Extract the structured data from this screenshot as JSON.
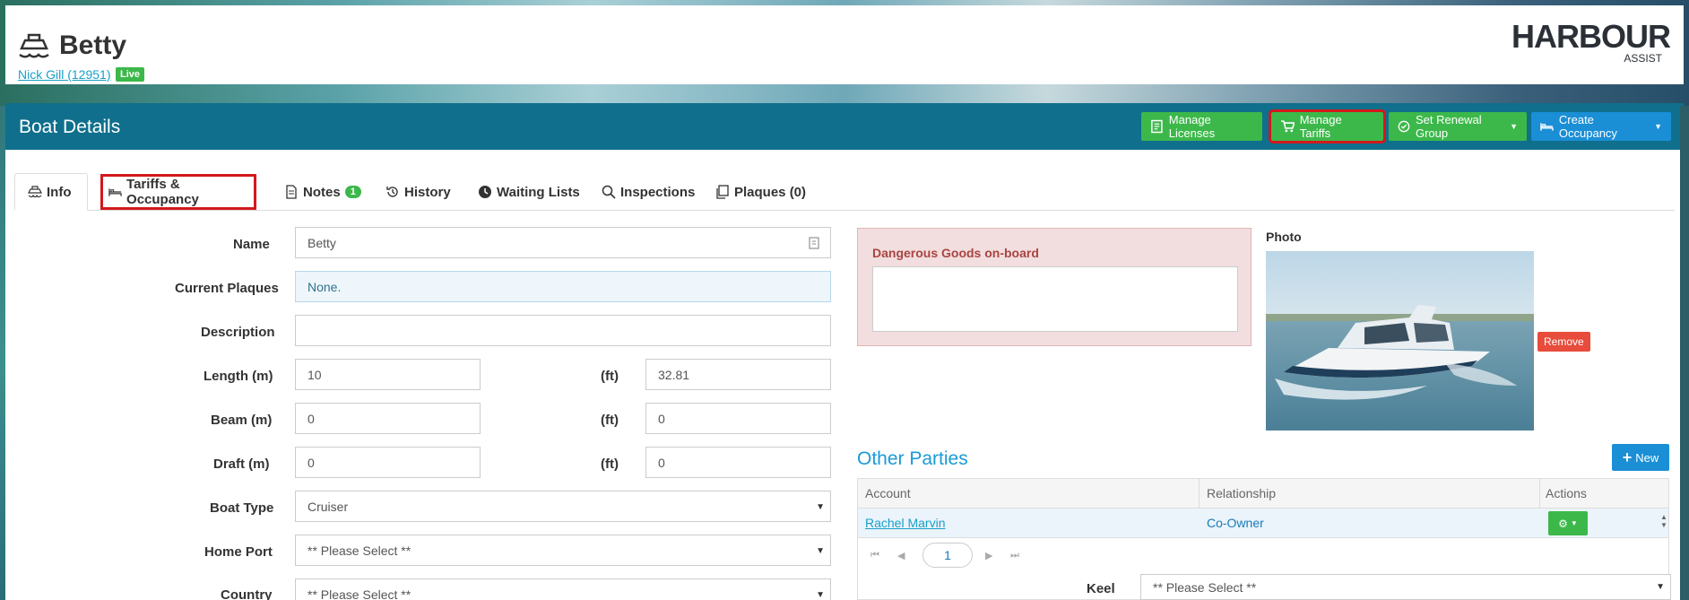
{
  "header": {
    "boat_name": "Betty",
    "owner_link": "Nick Gill (12951)",
    "status_badge": "Live",
    "logo_text": "HARBOUR",
    "logo_sub": "ASSIST"
  },
  "panel": {
    "title": "Boat Details",
    "actions": [
      {
        "label": "Manage Licenses",
        "icon": "license-icon"
      },
      {
        "label": "Manage Tariffs",
        "icon": "cart-icon"
      },
      {
        "label": "Set Renewal Group",
        "icon": "check-circle-icon"
      },
      {
        "label": "Create Occupancy",
        "icon": "bed-icon"
      }
    ]
  },
  "tabs": [
    {
      "label": "Info",
      "icon": "boat-icon"
    },
    {
      "label": "Tariffs & Occupancy",
      "icon": "bed-icon"
    },
    {
      "label": "Notes",
      "icon": "document-icon",
      "badge": "1"
    },
    {
      "label": "History",
      "icon": "history-icon"
    },
    {
      "label": "Waiting Lists",
      "icon": "clock-icon"
    },
    {
      "label": "Inspections",
      "icon": "search-icon"
    },
    {
      "label": "Plaques (0)",
      "icon": "copy-icon"
    }
  ],
  "form": {
    "name_label": "Name",
    "name_value": "Betty",
    "plaques_label": "Current Plaques",
    "plaques_value": "None.",
    "description_label": "Description",
    "description_value": "",
    "length_label": "Length (m)",
    "length_m": "10",
    "length_ft_label": "(ft)",
    "length_ft": "32.81",
    "beam_label": "Beam (m)",
    "beam_m": "0",
    "beam_ft_label": "(ft)",
    "beam_ft": "0",
    "draft_label": "Draft (m)",
    "draft_m": "0",
    "draft_ft_label": "(ft)",
    "draft_ft": "0",
    "boat_type_label": "Boat Type",
    "boat_type_value": "Cruiser",
    "home_port_label": "Home Port",
    "home_port_value": "** Please Select **",
    "country_label": "Country",
    "country_value": "** Please Select **"
  },
  "dangerous_goods": {
    "title": "Dangerous Goods on-board",
    "value": ""
  },
  "photo": {
    "label": "Photo",
    "remove_label": "Remove"
  },
  "other_parties": {
    "title": "Other Parties",
    "new_label": "New",
    "columns": [
      "Account",
      "Relationship",
      "Actions"
    ],
    "rows": [
      {
        "account": "Rachel Marvin",
        "relationship": "Co-Owner"
      }
    ],
    "current_page": "1"
  },
  "keel": {
    "label": "Keel",
    "value": "** Please Select **"
  }
}
